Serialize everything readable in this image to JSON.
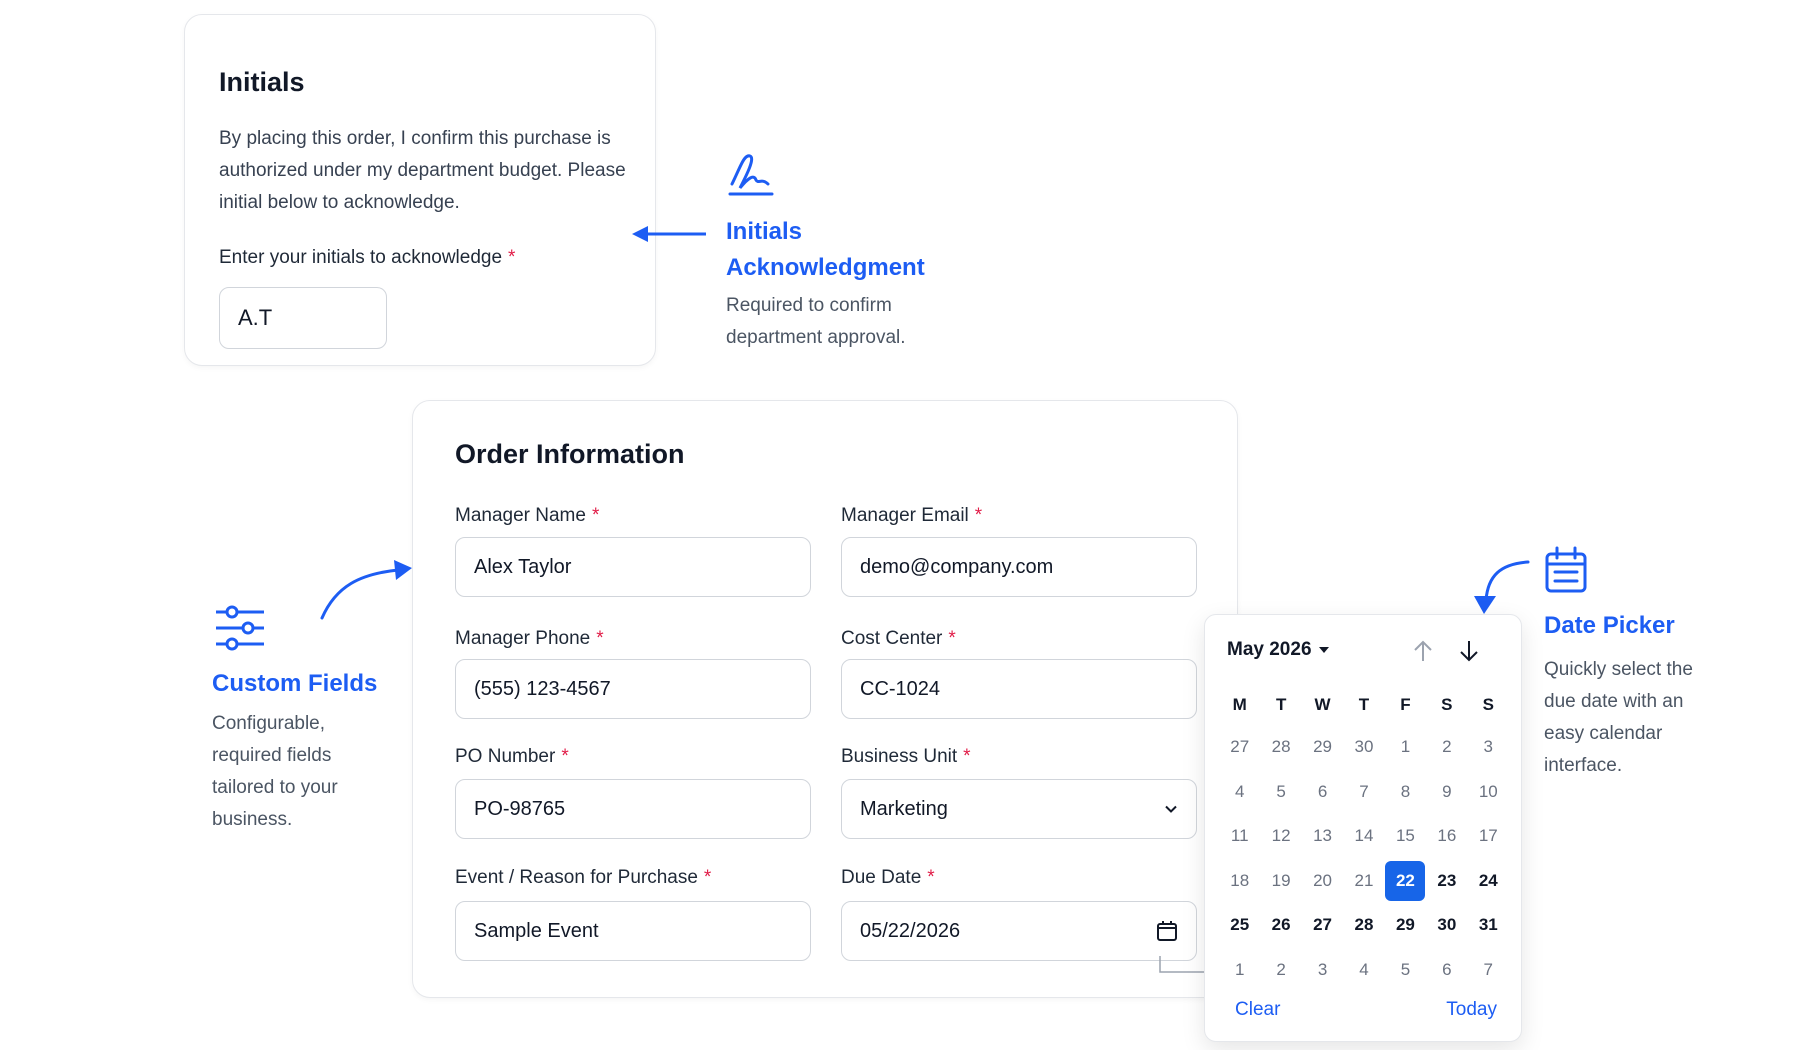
{
  "initials": {
    "title": "Initials",
    "description": "By placing this order, I confirm this purchase is authorized under my department budget. Please initial below to acknowledge.",
    "field_label": "Enter your initials to acknowledge",
    "value": "A.T"
  },
  "callouts": {
    "initials": {
      "title": "Initials Acknowledgment",
      "text": "Required to confirm department approval."
    },
    "custom_fields": {
      "title": "Custom Fields",
      "text": "Configurable, required fields tailored to your business."
    },
    "date_picker": {
      "title": "Date Picker",
      "text": "Quickly select the due date with an easy calendar interface."
    }
  },
  "order": {
    "title": "Order Information",
    "fields": {
      "manager_name": {
        "label": "Manager Name",
        "value": "Alex Taylor"
      },
      "manager_email": {
        "label": "Manager Email",
        "value": "demo@company.com"
      },
      "manager_phone": {
        "label": "Manager Phone",
        "value": "(555) 123-4567"
      },
      "cost_center": {
        "label": "Cost Center",
        "value": "CC-1024"
      },
      "po_number": {
        "label": "PO Number",
        "value": "PO-98765"
      },
      "business_unit": {
        "label": "Business Unit",
        "value": "Marketing"
      },
      "event_reason": {
        "label": "Event / Reason for Purchase",
        "value": "Sample Event"
      },
      "due_date": {
        "label": "Due Date",
        "value": "05/22/2026"
      }
    },
    "required_marker": "*"
  },
  "calendar": {
    "month_label": "May 2026",
    "weekdays": [
      "M",
      "T",
      "W",
      "T",
      "F",
      "S",
      "S"
    ],
    "weeks": [
      [
        27,
        28,
        29,
        30,
        1,
        2,
        3
      ],
      [
        4,
        5,
        6,
        7,
        8,
        9,
        10
      ],
      [
        11,
        12,
        13,
        14,
        15,
        16,
        17
      ],
      [
        18,
        19,
        20,
        21,
        22,
        23,
        24
      ],
      [
        25,
        26,
        27,
        28,
        29,
        30,
        31
      ],
      [
        1,
        2,
        3,
        4,
        5,
        6,
        7
      ]
    ],
    "selected_day": 22,
    "clear_label": "Clear",
    "today_label": "Today"
  },
  "colors": {
    "accent": "#1d5df3",
    "selected": "#1765e8",
    "required": "#e11d48"
  },
  "icons": {
    "initials_callout": "signature-icon",
    "custom_fields_callout": "sliders-icon",
    "date_picker_callout": "calendar-icon"
  }
}
